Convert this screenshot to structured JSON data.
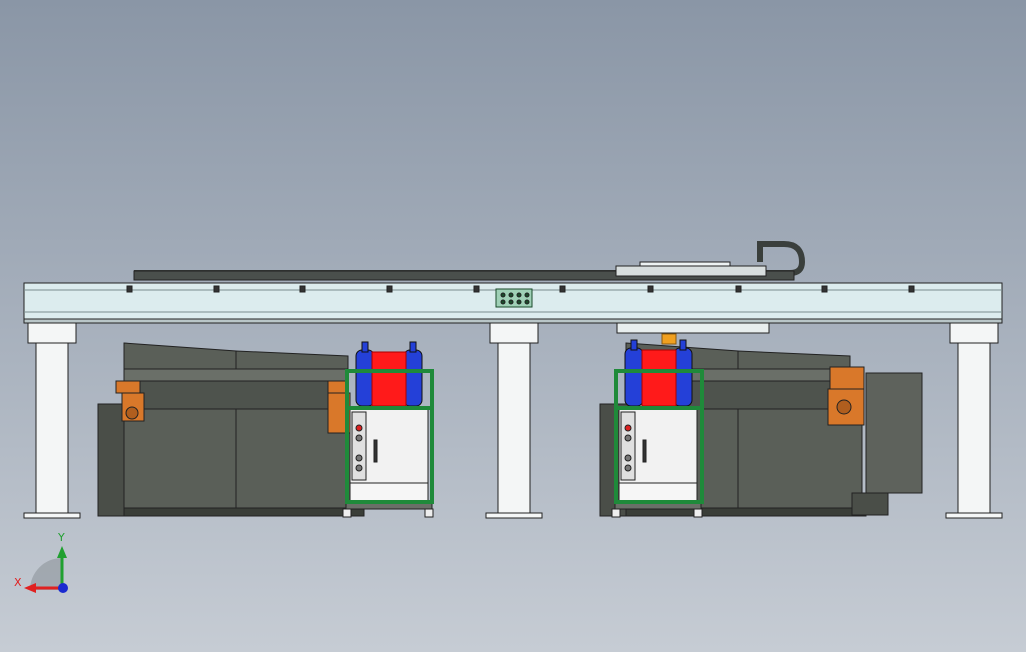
{
  "viewer": {
    "background_top": "#8a96a6",
    "background_bottom": "#c6ccd4"
  },
  "model": {
    "gantry_color": "#dcecee",
    "machine_body_color": "#5a5f58",
    "safety_frame_color": "#1f8a3a",
    "cylinder_color": "#2440d8",
    "warning_block_color": "#ff1a1a",
    "robot_color": "#d9782a",
    "cabinet_color": "#f2f2f2"
  },
  "triad": {
    "x_label": "X",
    "y_label": "Y",
    "x_color": "#e02020",
    "y_color": "#20a030",
    "z_color": "#1a2ad0"
  }
}
